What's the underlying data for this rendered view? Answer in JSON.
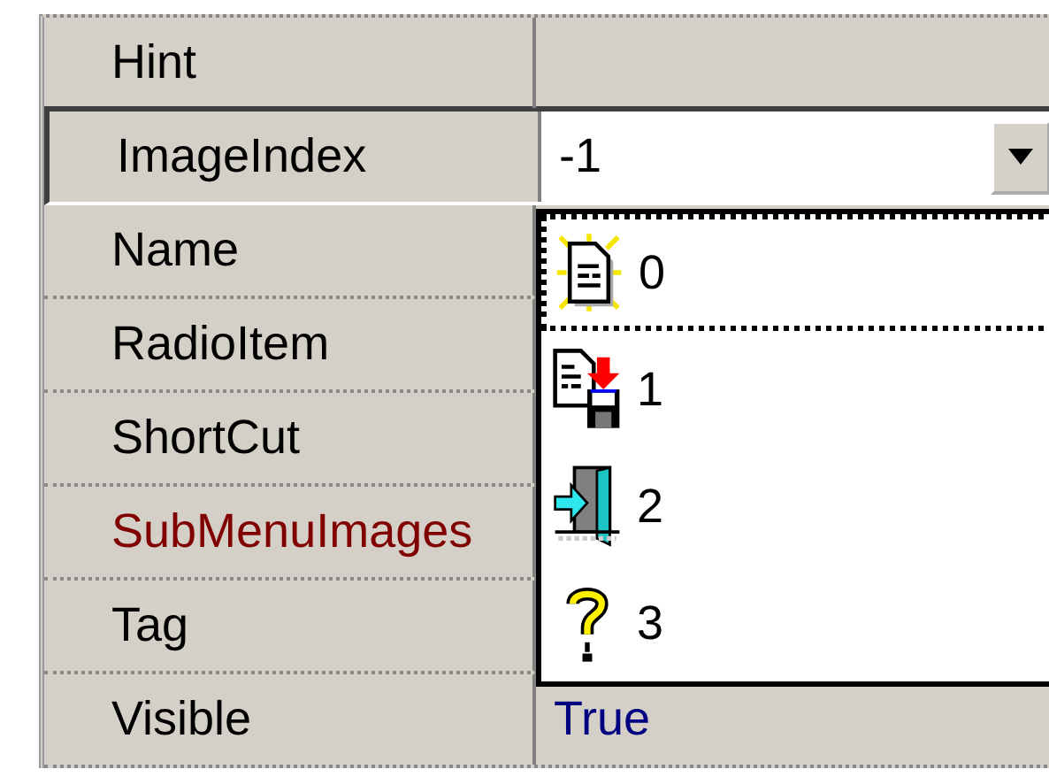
{
  "properties": [
    {
      "name": "Hint",
      "kind": "plain",
      "selected": false
    },
    {
      "name": "ImageIndex",
      "kind": "plain",
      "selected": true,
      "value": "-1"
    },
    {
      "name": "Name",
      "kind": "plain",
      "selected": false
    },
    {
      "name": "RadioItem",
      "kind": "plain",
      "selected": false
    },
    {
      "name": "ShortCut",
      "kind": "plain",
      "selected": false
    },
    {
      "name": "SubMenuImages",
      "kind": "reference",
      "selected": false
    },
    {
      "name": "Tag",
      "kind": "plain",
      "selected": false
    },
    {
      "name": "Visible",
      "kind": "plain",
      "selected": false,
      "value": "True"
    }
  ],
  "dropdown": {
    "expanded": true,
    "items": [
      {
        "label": "0",
        "selected": true
      },
      {
        "label": "1",
        "selected": false
      },
      {
        "label": "2",
        "selected": false
      },
      {
        "label": "3",
        "selected": false
      }
    ]
  }
}
